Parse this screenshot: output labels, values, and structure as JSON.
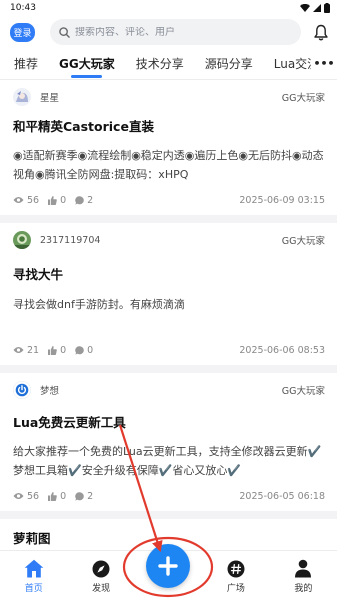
{
  "status_bar": {
    "time": "10:43"
  },
  "header": {
    "login_label": "登录",
    "search_placeholder": "搜索内容、评论、用户",
    "more_label": "•••"
  },
  "tabs": [
    {
      "label": "推荐",
      "active": false
    },
    {
      "label": "GG大玩家",
      "active": true
    },
    {
      "label": "技术分享",
      "active": false
    },
    {
      "label": "源码分享",
      "active": false
    },
    {
      "label": "Lua交流",
      "active": false
    }
  ],
  "posts": [
    {
      "author": "星星",
      "category": "GG大玩家",
      "title": "和平精英Castorice直装",
      "excerpt": "◉适配新赛季◉流程绘制◉稳定内透◉遍历上色◉无后防抖◉动态视角◉腾讯全防网盘:提取码：xHPQ",
      "views": "56",
      "likes": "0",
      "comments": "2",
      "date": "2025-06-09 03:15"
    },
    {
      "author": "2317119704",
      "category": "GG大玩家",
      "title": "寻找大牛",
      "excerpt": "寻找会做dnf手游防封。有麻烦滴滴",
      "views": "21",
      "likes": "0",
      "comments": "0",
      "date": "2025-06-06 08:53"
    },
    {
      "author": "梦想",
      "category": "GG大玩家",
      "title": "Lua免费云更新工具",
      "excerpt": "给大家推荐一个免费的Lua云更新工具，支持全修改器云更新✔️梦想工具箱✔️安全升级有保障✔️省心又放心✔️",
      "views": "56",
      "likes": "0",
      "comments": "2",
      "date": "2025-06-05 06:18"
    }
  ],
  "partial_post": {
    "title": "萝莉图"
  },
  "bottom_nav": [
    {
      "label": "首页",
      "active": true,
      "icon": "home-icon"
    },
    {
      "label": "发现",
      "active": false,
      "icon": "compass-icon"
    },
    {
      "label": "",
      "active": false,
      "icon": "plus-icon"
    },
    {
      "label": "广场",
      "active": false,
      "icon": "hash-icon"
    },
    {
      "label": "我的",
      "active": false,
      "icon": "person-icon"
    }
  ],
  "colors": {
    "accent": "#2f7cf6",
    "fab": "#1e86f2",
    "annotation": "#e23b2e"
  }
}
